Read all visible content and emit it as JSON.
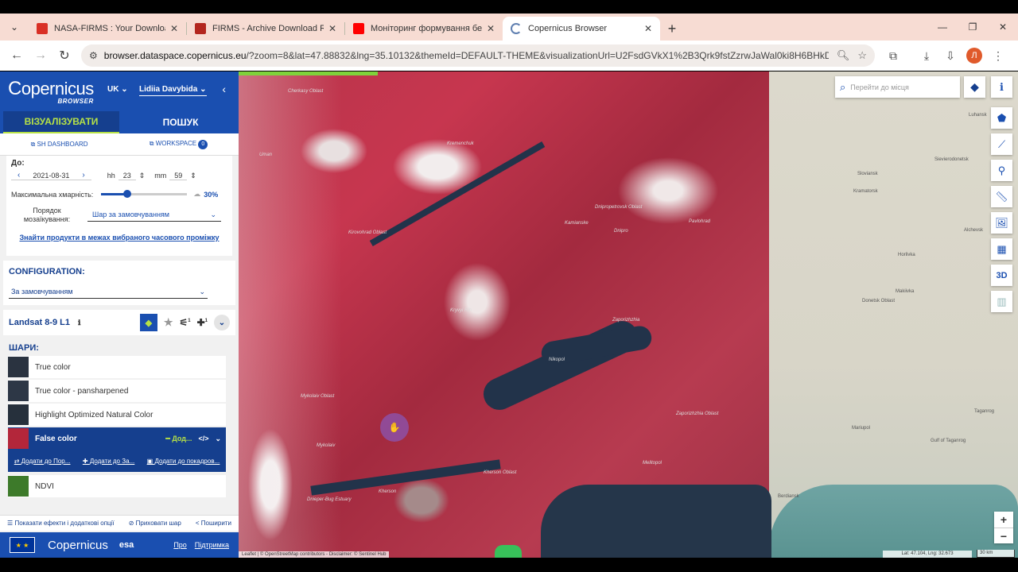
{
  "browser": {
    "tabs": [
      {
        "title": "NASA-FIRMS : Your Download R",
        "favicon_color": "#d93025"
      },
      {
        "title": "FIRMS - Archive Download Req",
        "favicon_color": "#b3261e"
      },
      {
        "title": "Моніторинг формування белі",
        "favicon_color": "#ff0000"
      },
      {
        "title": "Copernicus Browser",
        "favicon_color": "#5f7fb0"
      }
    ],
    "url_host": "browser.dataspace.copernicus.eu",
    "url_rest": "/?zoom=8&lat=47.88832&lng=35.10132&themeId=DEFAULT-THEME&visualizationUrl=U2FsdGVkX1%2B3Qrk9fstZzrwJaWal0ki8H6BHkDxTVJcX...",
    "profile_initial": "Л"
  },
  "header": {
    "logo_text": "opernicus",
    "logo_sub": "BROWSER",
    "language": "UK",
    "user": "Lidiia Davybida",
    "tab_visualize": "ВІЗУАЛІЗУВАТИ",
    "tab_search": "ПОШУК",
    "sh_dashboard": "SH DASHBOARD",
    "workspace": "WORKSPACE",
    "workspace_count": "0"
  },
  "date_panel": {
    "label_to": "До:",
    "date": "2021-08-31",
    "hh_label": "hh",
    "hh_value": "23",
    "mm_label": "mm",
    "mm_value": "59",
    "cloud_label": "Максимальна хмарність:",
    "cloud_value": "30%",
    "cloud_fraction": 0.3,
    "mosaic_label": "Порядок мозаїкування:",
    "mosaic_value": "Шар за замовчуванням",
    "find_link": "Знайти продукти в межах вибраного часового проміжку"
  },
  "configuration": {
    "title": "CONFIGURATION:",
    "value": "За замовчуванням"
  },
  "dataset": {
    "name": "Landsat 8-9 L1",
    "filter_count": "1",
    "pin_count": "1"
  },
  "layers": {
    "title": "ШАРИ:",
    "items": [
      {
        "label": "True color",
        "thumb": "#2a3340"
      },
      {
        "label": "True color - pansharpened",
        "thumb": "#2d3746"
      },
      {
        "label": "Highlight Optimized Natural Color",
        "thumb": "#26303c"
      },
      {
        "label": "False color",
        "thumb": "#b3263a"
      },
      {
        "label": "NDVI",
        "thumb": "#3d7a2a"
      }
    ],
    "active_add": "Дод...",
    "action_pin": "Додати до Пор...",
    "action_compare": "Додати до За...",
    "action_timelapse": "Додати до покадров..."
  },
  "effects": {
    "show_effects": "Показати ефекти і додаткові опції",
    "hide_layer": "Приховати шар",
    "share": "Поширити"
  },
  "footer": {
    "eu": "★ ★",
    "logo": "opernicus",
    "esa": "esa",
    "about": "Про",
    "support": "Підтримка"
  },
  "map": {
    "search_placeholder": "Перейти до місця",
    "attribution": "Leaflet | © OpenStreetMap contributors - Disclaimer: © Sentinel Hub",
    "coords": "Lat: 47.104, Lng: 32.673",
    "scale": "30 km",
    "sat_places": [
      {
        "name": "Kremenchuk"
      },
      {
        "name": "Kirovohrad Oblast"
      },
      {
        "name": "Dnipropetrovsk Oblast"
      },
      {
        "name": "Kamianske"
      },
      {
        "name": "Dnipro"
      },
      {
        "name": "Pavlohrad"
      },
      {
        "name": "Kryvyi Rih"
      },
      {
        "name": "Zaporizhzhia"
      },
      {
        "name": "Nikopol"
      },
      {
        "name": "Mykolaiv Oblast"
      },
      {
        "name": "Mykolaiv"
      },
      {
        "name": "Kherson"
      },
      {
        "name": "Kherson Oblast"
      },
      {
        "name": "Melitopol"
      },
      {
        "name": "Zaporizhzhia Oblast"
      },
      {
        "name": "Dnieper-Bug Estuary"
      },
      {
        "name": "Cherkasy Oblast"
      },
      {
        "name": "Uman"
      }
    ],
    "osm_places": [
      {
        "name": "Sloviansk"
      },
      {
        "name": "Kramatorsk"
      },
      {
        "name": "Sievierodonetsk"
      },
      {
        "name": "Horlivka"
      },
      {
        "name": "Donetsk Oblast"
      },
      {
        "name": "Makiivka"
      },
      {
        "name": "Mariupol"
      },
      {
        "name": "Gulf of Taganrog"
      },
      {
        "name": "Berdiansk"
      },
      {
        "name": "Taganrog"
      },
      {
        "name": "Alchevsk"
      },
      {
        "name": "Luhansk"
      }
    ]
  },
  "colors": {
    "brand_blue": "#1a4fb0",
    "dark_blue": "#153f8e",
    "accent_green": "#b6e146"
  }
}
